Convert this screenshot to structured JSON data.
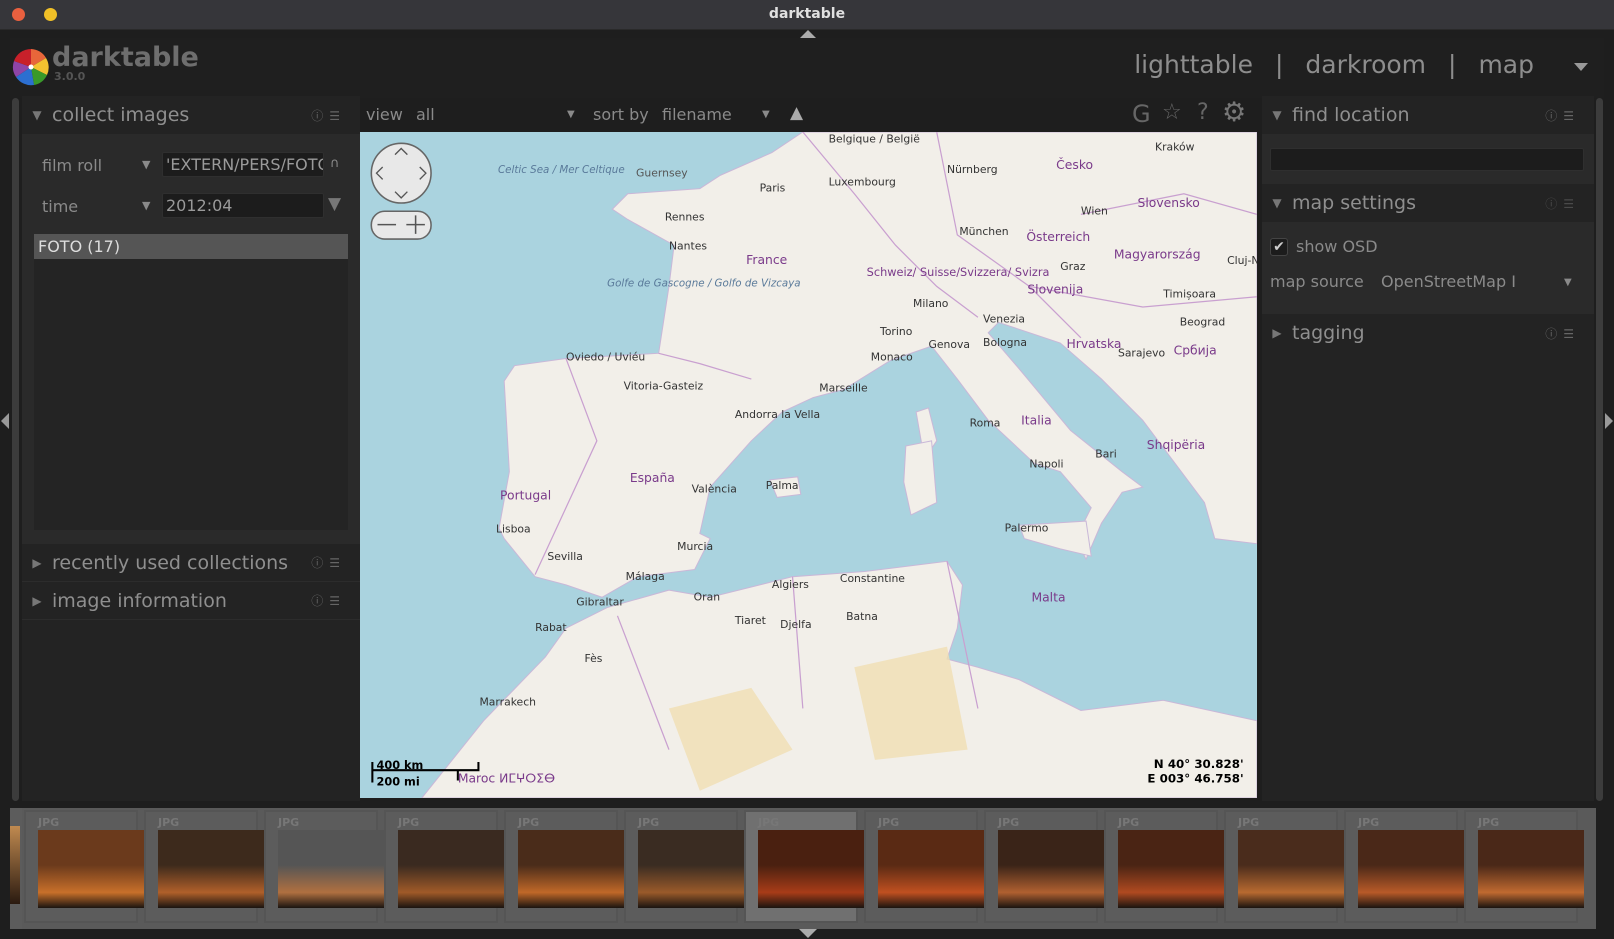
{
  "window": {
    "title": "darktable"
  },
  "app": {
    "name": "darktable",
    "version": "3.0.0"
  },
  "views": {
    "items": [
      "lighttable",
      "darkroom",
      "map"
    ],
    "separator": "|"
  },
  "left_panel": {
    "collect": {
      "title": "collect images",
      "rows": [
        {
          "property": "film roll",
          "value": "'EXTERN/PERS/FOTO"
        },
        {
          "property": "time",
          "value": "2012:04"
        }
      ],
      "results": [
        {
          "label": "FOTO (17)"
        }
      ]
    },
    "recent": {
      "title": "recently used collections"
    },
    "info": {
      "title": "image information"
    }
  },
  "toolbar": {
    "view_label": "view",
    "view_value": "all",
    "sort_label": "sort by",
    "sort_value": "filename",
    "icons": [
      "grouping-G",
      "star",
      "help",
      "gear"
    ]
  },
  "map": {
    "osd": {
      "lat": "N 40° 30.828'",
      "lon": "E 003° 46.758'"
    },
    "scale": {
      "km": "400 km",
      "mi": "200 mi"
    },
    "labels": [
      "Paris",
      "Rennes",
      "Nantes",
      "France",
      "Luxembourg",
      "Nürnberg",
      "München",
      "Wien",
      "Česko",
      "Kraków",
      "Slovensko",
      "Österreich",
      "Magyarország",
      "Schweiz/ Suisse/Svizzera/ Svizra",
      "Milano",
      "Venezia",
      "Torino",
      "Genova",
      "Bologna",
      "Monaco",
      "Marseille",
      "Slovenija",
      "Hrvatska",
      "Italia",
      "Roma",
      "Napoli",
      "Bari",
      "Palermo",
      "Sarajevo",
      "Србија",
      "Beograd",
      "Timișoara",
      "Shqipëria",
      "España",
      "Portugal",
      "Lisboa",
      "Sevilla",
      "Málaga",
      "Murcia",
      "València",
      "Palma",
      "Andorra la Vella",
      "Vitoria-Gasteiz",
      "Oviedo / Uviéu",
      "Gibraltar",
      "Oran",
      "Algiers",
      "Constantine",
      "Batna",
      "Djelfa",
      "Tiaret",
      "Rabat",
      "Fès",
      "Marrakech",
      "Malta",
      "Guernsey",
      "Celtic Sea / Mer Celtique",
      "Golfe de Gascogne / Golfo de Vizcaya",
      "Maroc ⵍⵎⵖⵔⵉⴱ",
      "Belgique / België",
      "Graz",
      "Cluj-N"
    ]
  },
  "right_panel": {
    "find": {
      "title": "find location",
      "search_value": ""
    },
    "map_settings": {
      "title": "map settings",
      "show_osd_label": "show OSD",
      "show_osd": true,
      "map_source_label": "map source",
      "map_source_value": "OpenStreetMap I"
    },
    "tagging": {
      "title": "tagging"
    }
  },
  "filmstrip": {
    "format": "JPG",
    "count": 13,
    "selected_index": 6
  }
}
